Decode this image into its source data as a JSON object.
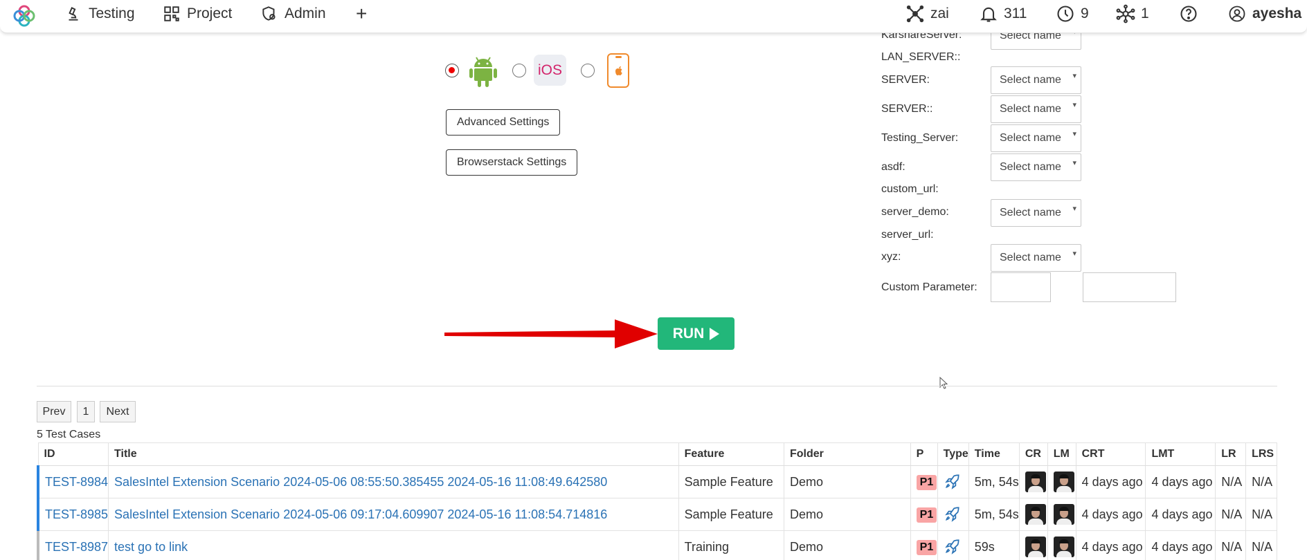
{
  "nav": {
    "items": [
      {
        "label": "Testing",
        "icon": "microscope-icon"
      },
      {
        "label": "Project",
        "icon": "qr-grid-icon"
      },
      {
        "label": "Admin",
        "icon": "shield-gear-icon"
      }
    ],
    "add_label": "+",
    "right": {
      "workspace": "zai",
      "notifications": "311",
      "history": "9",
      "network": "1",
      "user": "ayesha"
    }
  },
  "platforms": {
    "selected": "android",
    "ios_label": "iOS"
  },
  "buttons": {
    "advanced": "Advanced Settings",
    "browserstack": "Browserstack Settings",
    "run": "RUN"
  },
  "parameters": [
    {
      "label": "KarshareServer:",
      "select": "Select name"
    },
    {
      "label": "LAN_SERVER::",
      "select": ""
    },
    {
      "label": "SERVER:",
      "select": "Select name"
    },
    {
      "label": "SERVER::",
      "select": "Select name"
    },
    {
      "label": "Testing_Server:",
      "select": "Select name"
    },
    {
      "label": "asdf:",
      "select": "Select name"
    },
    {
      "label": "custom_url:",
      "select": ""
    },
    {
      "label": "server_demo:",
      "select": "Select name"
    },
    {
      "label": "server_url:",
      "select": ""
    },
    {
      "label": "xyz:",
      "select": "Select name"
    },
    {
      "label": "Custom Parameter:",
      "select": ""
    }
  ],
  "pagination": {
    "prev": "Prev",
    "page": "1",
    "next": "Next",
    "count_text": "5 Test Cases"
  },
  "table": {
    "headers": [
      "ID",
      "Title",
      "Feature",
      "Folder",
      "P",
      "Type",
      "Time",
      "CR",
      "LM",
      "CRT",
      "LMT",
      "LR",
      "LRS"
    ],
    "rows": [
      {
        "id": "TEST-8984",
        "title": "SalesIntel Extension Scenario 2024-05-06 08:55:50.385455 2024-05-16 11:08:49.642580",
        "feature": "Sample Feature",
        "folder": "Demo",
        "p": "P1",
        "time": "5m, 54s",
        "crt": "4 days ago",
        "lmt": "4 days ago",
        "lr": "N/A",
        "lrs": "N/A"
      },
      {
        "id": "TEST-8985",
        "title": "SalesIntel Extension Scenario 2024-05-06 09:17:04.609907 2024-05-16 11:08:54.714816",
        "feature": "Sample Feature",
        "folder": "Demo",
        "p": "P1",
        "time": "5m, 54s",
        "crt": "4 days ago",
        "lmt": "4 days ago",
        "lr": "N/A",
        "lrs": "N/A"
      },
      {
        "id": "TEST-8987",
        "title": "test go to link",
        "feature": "Training",
        "folder": "Demo",
        "p": "P1",
        "time": "59s",
        "crt": "4 days ago",
        "lmt": "4 days ago",
        "lr": "N/A",
        "lrs": "N/A"
      }
    ]
  },
  "colors": {
    "accent_green": "#22b77a",
    "link_blue": "#2a72b5",
    "priority_badge": "#f9a5a5",
    "arrow_red": "#e00000"
  }
}
